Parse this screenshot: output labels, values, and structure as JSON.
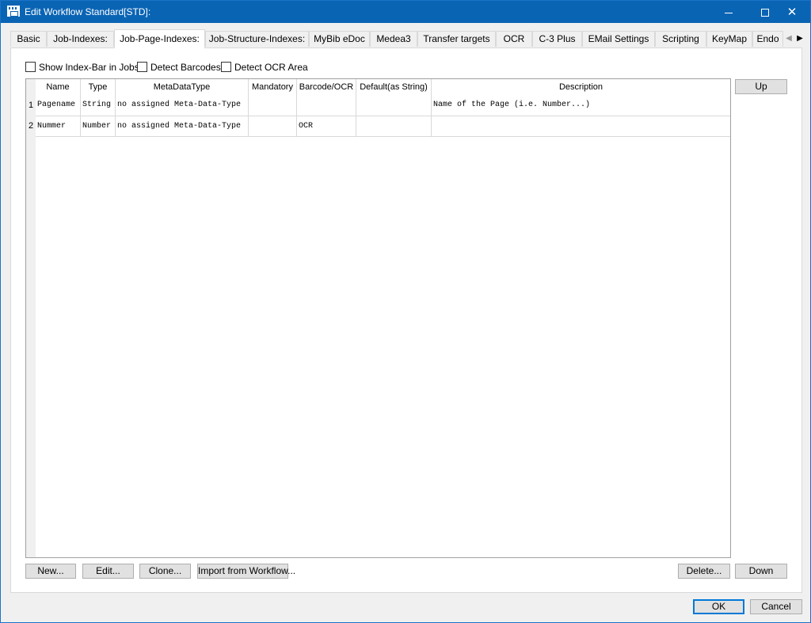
{
  "window": {
    "title": "Edit Workflow Standard[STD]:",
    "minimize_icon": "minimize-icon",
    "maximize_icon": "maximize-icon",
    "close_symbol": "✕"
  },
  "tabs": [
    {
      "label": "Basic"
    },
    {
      "label": "Job-Indexes:"
    },
    {
      "label": "Job-Page-Indexes:"
    },
    {
      "label": "Job-Structure-Indexes:"
    },
    {
      "label": "MyBib eDoc"
    },
    {
      "label": "Medea3"
    },
    {
      "label": "Transfer targets"
    },
    {
      "label": "OCR"
    },
    {
      "label": "C-3 Plus"
    },
    {
      "label": "EMail Settings"
    },
    {
      "label": "Scripting"
    },
    {
      "label": "KeyMap"
    },
    {
      "label": "Endo"
    }
  ],
  "active_tab": "Job-Page-Indexes:",
  "tab_scroll": {
    "left": "◀",
    "right": "▶"
  },
  "options": {
    "show_index_bar": {
      "label": "Show Index-Bar in Jobs",
      "checked": false
    },
    "detect_barcodes": {
      "label": "Detect Barcodes",
      "checked": false
    },
    "detect_ocr_area": {
      "label": "Detect OCR Area",
      "checked": false
    }
  },
  "table": {
    "columns": [
      "Name",
      "Type",
      "MetaDataType",
      "Mandatory",
      "Barcode/OCR",
      "Default(as String)",
      "Description"
    ],
    "rows": [
      {
        "num": "1",
        "cells": [
          "Pagename",
          "String",
          "no assigned Meta-Data-Type",
          "",
          "",
          "",
          "Name of the Page (i.e. Number...)"
        ]
      },
      {
        "num": "2",
        "cells": [
          "Nummer",
          "Number",
          "no assigned Meta-Data-Type",
          "",
          "OCR",
          "",
          ""
        ]
      }
    ]
  },
  "side_buttons": {
    "up": "Up",
    "down": "Down"
  },
  "bottom_buttons": {
    "new": "New...",
    "edit": "Edit...",
    "clone": "Clone...",
    "import": "Import from Workflow...",
    "delete": "Delete..."
  },
  "dialog_buttons": {
    "ok": "OK",
    "cancel": "Cancel"
  }
}
